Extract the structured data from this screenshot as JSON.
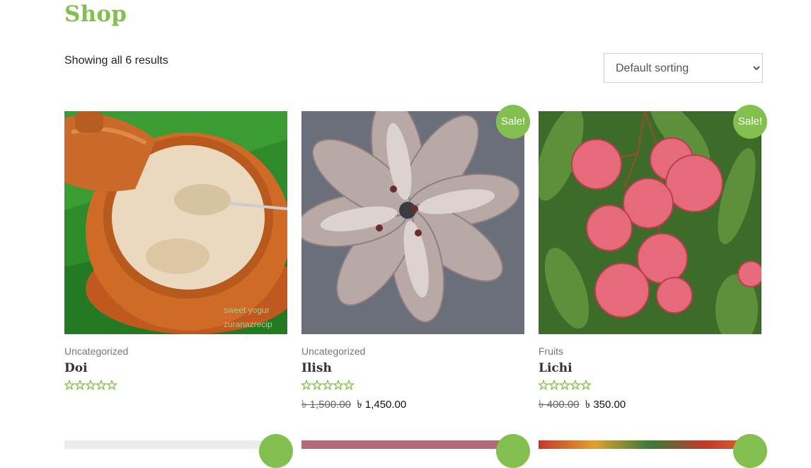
{
  "page": {
    "title": "Shop",
    "result_count": "Showing all 6 results"
  },
  "sorting": {
    "selected": "Default sorting",
    "options": [
      "Default sorting"
    ]
  },
  "colors": {
    "accent": "#83bf4f"
  },
  "products": [
    {
      "category": "Uncategorized",
      "name": "Doi",
      "rating": 0,
      "sale_badge": "",
      "price_old": "",
      "price_new": ""
    },
    {
      "category": "Uncategorized",
      "name": "Ilish",
      "rating": 0,
      "sale_badge": "Sale!",
      "price_old": "৳ 1,500.00",
      "price_new": "৳ 1,450.00"
    },
    {
      "category": "Fruits",
      "name": "Lichi",
      "rating": 0,
      "sale_badge": "Sale!",
      "price_old": "৳ 400.00",
      "price_new": "৳ 350.00"
    }
  ],
  "image_watermark": "sweet yogurt zuranazrecipe"
}
